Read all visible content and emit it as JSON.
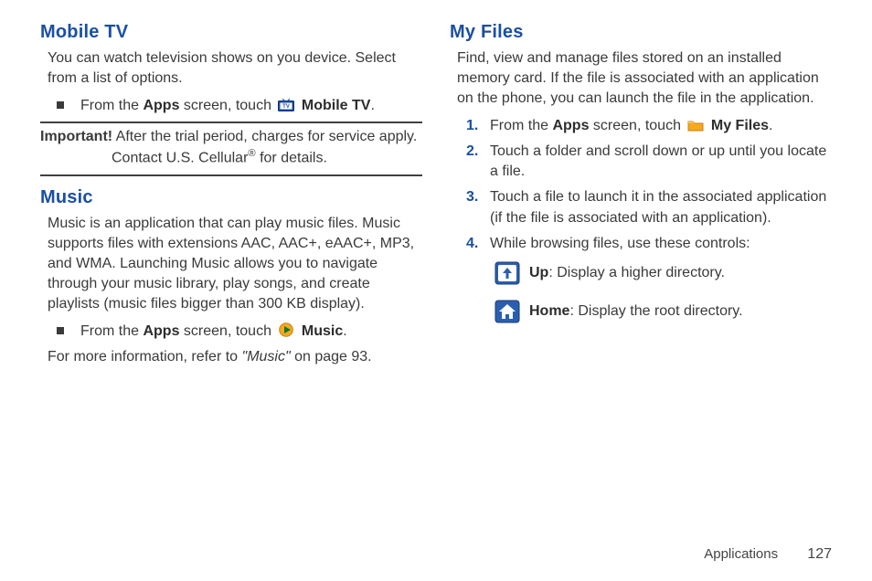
{
  "left": {
    "mobileTv": {
      "heading": "Mobile TV",
      "intro": "You can watch television shows on you device. Select from a list of options.",
      "bullet_pre": "From the ",
      "bullet_apps": "Apps",
      "bullet_mid": " screen, touch ",
      "bullet_app": "Mobile TV",
      "bullet_post": ".",
      "important_label": "Important!",
      "important_l1": " After the trial period, charges for service apply.",
      "important_l2": "Contact U.S. Cellular",
      "important_reg": "®",
      "important_l2b": " for details."
    },
    "music": {
      "heading": "Music",
      "intro": "Music is an application that can play music files. Music supports files with extensions AAC, AAC+, eAAC+, MP3, and WMA. Launching Music allows you to navigate through your music library, play songs, and create playlists (music files bigger than 300 KB display).",
      "bullet_pre": "From the ",
      "bullet_apps": "Apps",
      "bullet_mid": " screen, touch ",
      "bullet_app": "Music",
      "bullet_post": ".",
      "more_pre": "For more information, refer to ",
      "more_ref": "\"Music\"",
      "more_post": " on page 93."
    }
  },
  "right": {
    "myFiles": {
      "heading": "My Files",
      "intro": "Find, view and manage files stored on an installed memory card. If the file is associated with an application on the phone, you can launch the file in the application.",
      "steps": {
        "s1_pre": "From the ",
        "s1_apps": "Apps",
        "s1_mid": " screen, touch ",
        "s1_app": "My Files",
        "s1_post": ".",
        "s2": "Touch a folder and scroll down or up until you locate a file.",
        "s3": "Touch a file to launch it in the associated application (if the file is associated with an application).",
        "s4": "While browsing files, use these controls:"
      },
      "controls": {
        "up_b": "Up",
        "up_t": ": Display a higher directory.",
        "home_b": "Home",
        "home_t": ": Display the root directory."
      }
    }
  },
  "footer": {
    "section": "Applications",
    "page": "127"
  },
  "nums": {
    "n1": "1.",
    "n2": "2.",
    "n3": "3.",
    "n4": "4."
  }
}
